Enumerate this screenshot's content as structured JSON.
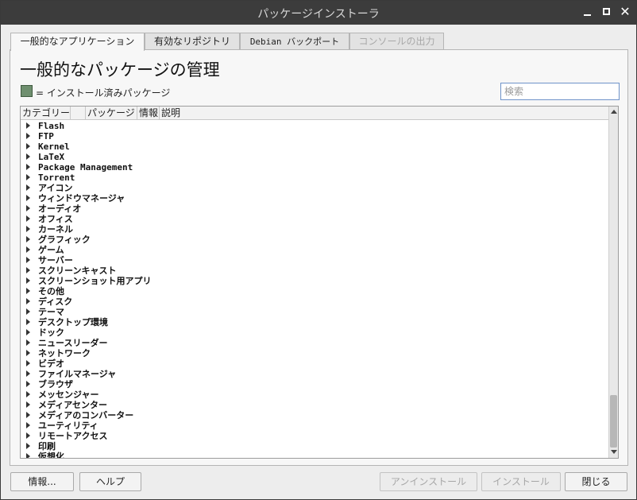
{
  "window": {
    "title": "パッケージインストーラ",
    "controls": {
      "minimize": "minimize-icon",
      "maximize": "maximize-icon",
      "close_glyph": "✕"
    }
  },
  "tabs": [
    {
      "label": "一般的なアプリケーション",
      "state": "active"
    },
    {
      "label": "有効なリポジトリ",
      "state": "normal"
    },
    {
      "label": "Debian バックポート",
      "state": "normal"
    },
    {
      "label": "コンソールの出力",
      "state": "disabled"
    }
  ],
  "main": {
    "heading": "一般的なパッケージの管理",
    "legend_text": "= インストール済みパッケージ",
    "legend_color": "#6f8f6f",
    "search_placeholder": "検索"
  },
  "tree": {
    "columns": [
      "カテゴリー",
      "",
      "パッケージ",
      "情報",
      "説明"
    ],
    "rows": [
      "Flash",
      "FTP",
      "Kernel",
      "LaTeX",
      "Package Management",
      "Torrent",
      "アイコン",
      "ウィンドウマネージャ",
      "オーディオ",
      "オフィス",
      "カーネル",
      "グラフィック",
      "ゲーム",
      "サーバー",
      "スクリーンキャスト",
      "スクリーンショット用アプリ",
      "その他",
      "ディスク",
      "テーマ",
      "デスクトップ環境",
      "ドック",
      "ニュースリーダー",
      "ネットワーク",
      "ビデオ",
      "ファイルマネージャ",
      "ブラウザ",
      "メッセンジャー",
      "メディアセンター",
      "メディアのコンバーター",
      "ユーティリティ",
      "リモートアクセス",
      "印刷",
      "仮想化"
    ],
    "scroll_fraction_visible": 0.79
  },
  "buttons": {
    "info": "情報...",
    "help": "ヘルプ",
    "uninstall": "アンインストール",
    "install": "インストール",
    "close": "閉じる"
  }
}
